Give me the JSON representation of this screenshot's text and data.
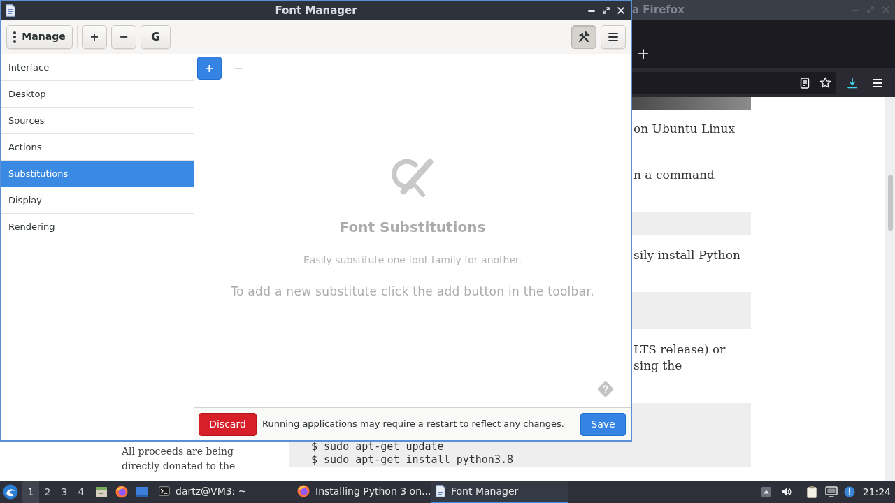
{
  "browser_window": {
    "title": "a Firefox",
    "new_tab_button": "+",
    "article": [
      {
        "kind": "paragraph",
        "lines": [
          "on Ubuntu Linux"
        ]
      },
      {
        "kind": "paragraph",
        "lines": [
          "n a command"
        ]
      },
      {
        "kind": "code"
      },
      {
        "kind": "paragraph",
        "lines": [
          "sily install Python"
        ]
      },
      {
        "kind": "code"
      },
      {
        "kind": "paragraph",
        "lines": [
          "LTS release) or",
          "sing the"
        ]
      },
      {
        "kind": "code",
        "lines": [
          "$ sudo apt-get update",
          "$ sudo apt-get install python3.8"
        ]
      }
    ],
    "sidebar_text": "All proceeds are being directly donated to the"
  },
  "font_manager": {
    "title": "Font Manager",
    "toolbar": {
      "manage_button": "Manage",
      "buttons": [
        "+",
        "−",
        "G"
      ],
      "tools_button": {
        "pressed": true
      }
    },
    "sidebar": [
      {
        "label": "Interface",
        "selected": false
      },
      {
        "label": "Desktop",
        "selected": false
      },
      {
        "label": "Sources",
        "selected": false
      },
      {
        "label": "Actions",
        "selected": false
      },
      {
        "label": "Substitutions",
        "selected": true
      },
      {
        "label": "Display",
        "selected": false
      },
      {
        "label": "Rendering",
        "selected": false
      }
    ],
    "pane_toolbar": {
      "add_button": "+",
      "remove_button": {
        "label": "−",
        "disabled": true
      }
    },
    "empty_state": {
      "title": "Font Substitutions",
      "subtitle": "Easily substitute one font family for another.",
      "hint": "To add a new substitute click the add button in the toolbar."
    },
    "footer": {
      "discard_button": "Discard",
      "message": "Running applications may require a restart to reflect any changes.",
      "save_button": "Save"
    }
  },
  "taskbar": {
    "workspaces": [
      {
        "label": "1",
        "selected": true
      },
      {
        "label": "2",
        "selected": false
      },
      {
        "label": "3",
        "selected": false
      },
      {
        "label": "4",
        "selected": false
      }
    ],
    "tasks": [
      {
        "kind": "terminal",
        "label": "dartz@VM3: ~",
        "selected": false
      },
      {
        "kind": "browser",
        "label": "Installing Python 3 on...",
        "selected": false
      },
      {
        "kind": "document",
        "label": "Font Manager",
        "selected": true
      }
    ],
    "clock": "21:24"
  }
}
